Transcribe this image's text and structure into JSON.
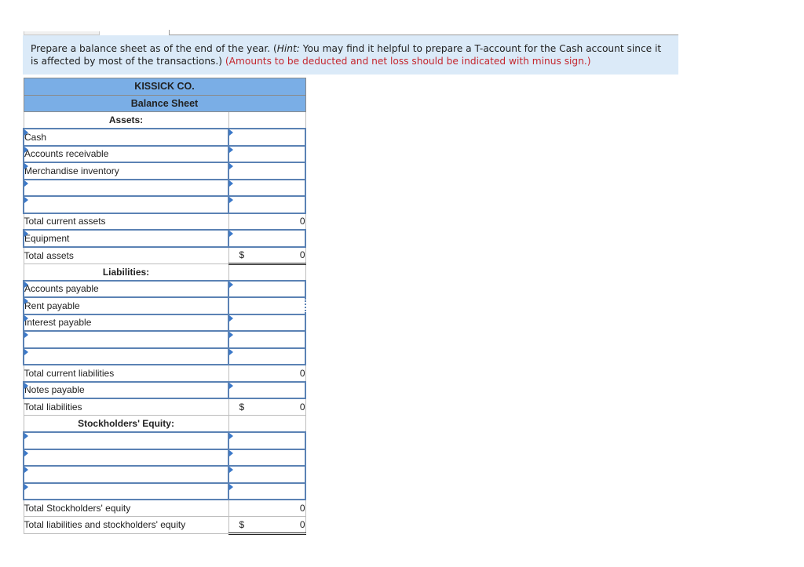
{
  "instructions": {
    "text_1": "Prepare a balance sheet as of the end of the year. (",
    "hint_label": "Hint:",
    "text_2": " You may find it helpful to prepare a T-account for the Cash account since it is affected by most of the transactions.) ",
    "red_note": "(Amounts to be deducted and net loss should be indicated with minus sign.)"
  },
  "colors": {
    "header_bg": "#7aaee6",
    "instruction_bg": "#dbeaf8",
    "input_border": "#5b82b4",
    "note_red": "#c4262e"
  },
  "balance_sheet": {
    "company": "KISSICK CO.",
    "title": "Balance Sheet",
    "assets_header": "Assets:",
    "assets": [
      {
        "label": "Cash",
        "value": ""
      },
      {
        "label": "Accounts receivable",
        "value": ""
      },
      {
        "label": "Merchandise inventory",
        "value": ""
      },
      {
        "label": "",
        "value": ""
      },
      {
        "label": "",
        "value": ""
      }
    ],
    "total_current_assets": {
      "label": "Total current assets",
      "value": "0"
    },
    "equipment": {
      "label": "Equipment",
      "value": ""
    },
    "total_assets": {
      "label": "Total assets",
      "currency": "$",
      "value": "0"
    },
    "liabilities_header": "Liabilities:",
    "liabilities": [
      {
        "label": "Accounts payable",
        "value": ""
      },
      {
        "label": "Rent payable",
        "value": ""
      },
      {
        "label": "Interest payable",
        "value": ""
      },
      {
        "label": "",
        "value": ""
      },
      {
        "label": "",
        "value": ""
      }
    ],
    "total_current_liabilities": {
      "label": "Total current liabilities",
      "value": "0"
    },
    "notes_payable": {
      "label": "Notes payable",
      "value": ""
    },
    "total_liabilities": {
      "label": "Total liabilities",
      "currency": "$",
      "value": "0"
    },
    "equity_header": "Stockholders' Equity:",
    "equity": [
      {
        "label": "",
        "value": ""
      },
      {
        "label": "",
        "value": ""
      },
      {
        "label": "",
        "value": ""
      },
      {
        "label": "",
        "value": ""
      }
    ],
    "total_equity": {
      "label": "Total Stockholders' equity",
      "value": "0"
    },
    "total_liabilities_equity": {
      "label": "Total liabilities and stockholders' equity",
      "currency": "$",
      "value": "0"
    }
  }
}
